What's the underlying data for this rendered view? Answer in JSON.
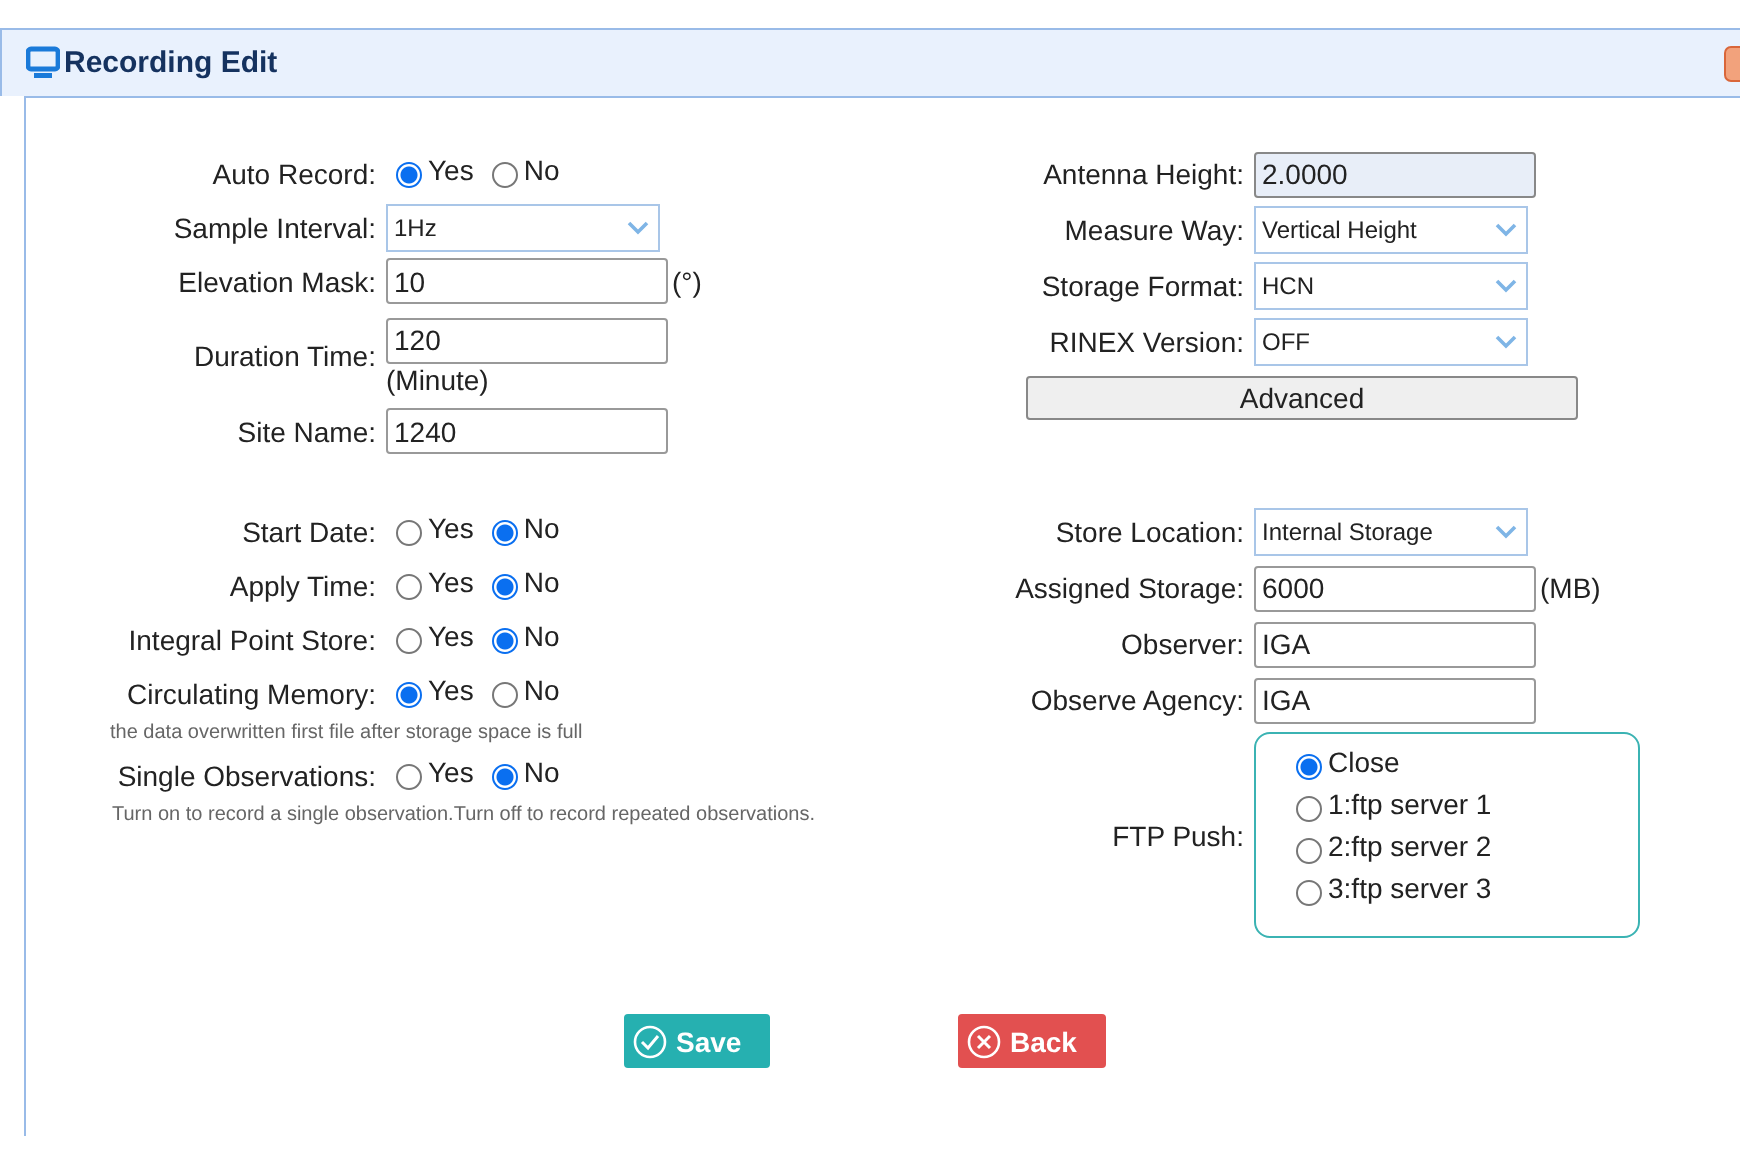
{
  "window": {
    "title": "Recording Edit"
  },
  "sections": [
    {
      "left": [
        {
          "kind": "radio",
          "label": "Auto Record:",
          "options": [
            {
              "label": "Yes",
              "selected": true
            },
            {
              "label": "No",
              "selected": false
            }
          ]
        },
        {
          "kind": "select",
          "label": "Sample Interval:",
          "value": "1Hz"
        },
        {
          "kind": "input",
          "label": "Elevation Mask:",
          "value": "10",
          "unit": "(°)",
          "unit_below": false
        },
        {
          "kind": "input",
          "label": "Duration Time:",
          "value": "120",
          "unit": "(Minute)",
          "unit_below": true
        },
        {
          "kind": "input",
          "label": "Site Name:",
          "value": "1240"
        }
      ],
      "right": [
        {
          "kind": "input",
          "label": "Antenna Height:",
          "value": "2.0000",
          "disabled": true
        },
        {
          "kind": "select",
          "label": "Measure Way:",
          "value": "Vertical Height"
        },
        {
          "kind": "select",
          "label": "Storage Format:",
          "value": "HCN"
        },
        {
          "kind": "select",
          "label": "RINEX Version:",
          "value": "OFF"
        },
        {
          "kind": "button",
          "label": "Advanced"
        }
      ]
    },
    {
      "left": [
        {
          "kind": "radio",
          "label": "Start Date:",
          "options": [
            {
              "label": "Yes",
              "selected": false
            },
            {
              "label": "No",
              "selected": true
            }
          ]
        },
        {
          "kind": "radio",
          "label": "Apply Time:",
          "options": [
            {
              "label": "Yes",
              "selected": false
            },
            {
              "label": "No",
              "selected": true
            }
          ]
        },
        {
          "kind": "radio",
          "label": "Integral Point Store:",
          "options": [
            {
              "label": "Yes",
              "selected": false
            },
            {
              "label": "No",
              "selected": true
            }
          ]
        },
        {
          "kind": "radio",
          "label": "Circulating Memory:",
          "options": [
            {
              "label": "Yes",
              "selected": true
            },
            {
              "label": "No",
              "selected": false
            }
          ],
          "note": "the data overwritten first file after storage space is full"
        },
        {
          "kind": "radio",
          "label": "Single Observations:",
          "options": [
            {
              "label": "Yes",
              "selected": false
            },
            {
              "label": "No",
              "selected": true
            }
          ],
          "note": "Turn on to record a single observation.Turn off to record repeated observations."
        }
      ],
      "right": [
        {
          "kind": "select",
          "label": "Store Location:",
          "value": "Internal Storage"
        },
        {
          "kind": "input",
          "label": "Assigned Storage:",
          "value": "6000",
          "unit": "(MB)",
          "unit_below": false
        },
        {
          "kind": "input",
          "label": "Observer:",
          "value": "IGA"
        },
        {
          "kind": "input",
          "label": "Observe Agency:",
          "value": "IGA"
        },
        {
          "kind": "radio-list",
          "label": "FTP Push:",
          "options": [
            {
              "label": "Close",
              "selected": true
            },
            {
              "label": "1:ftp server 1",
              "selected": false
            },
            {
              "label": "2:ftp server 2",
              "selected": false
            },
            {
              "label": "3:ftp server 3",
              "selected": false
            }
          ]
        }
      ]
    }
  ],
  "buttons": [
    {
      "kind": "save",
      "label": "Save"
    },
    {
      "kind": "back",
      "label": "Back"
    }
  ]
}
